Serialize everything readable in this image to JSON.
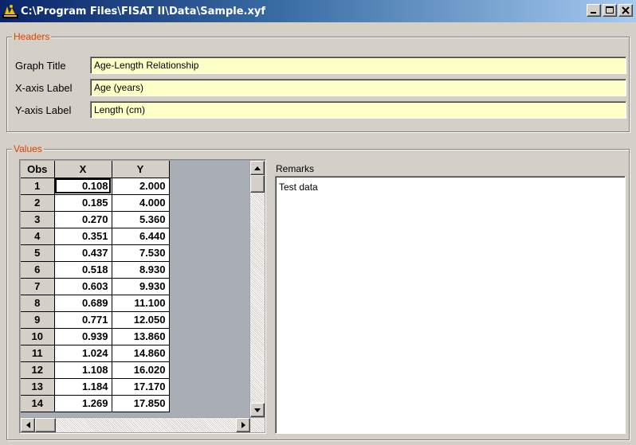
{
  "window": {
    "title": "C:\\Program Files\\FISAT II\\Data\\Sample.xyf",
    "icon": "fisat-app-icon"
  },
  "headers": {
    "legend": "Headers",
    "graph_title": {
      "label": "Graph Title",
      "value": "Age-Length Relationship"
    },
    "x_axis": {
      "label": "X-axis Label",
      "value": "Age (years)"
    },
    "y_axis": {
      "label": "Y-axis Label",
      "value": "Length (cm)"
    }
  },
  "values": {
    "legend": "Values",
    "columns": [
      "Obs",
      "X",
      "Y"
    ],
    "rows": [
      {
        "obs": "1",
        "x": "0.108",
        "y": "2.000"
      },
      {
        "obs": "2",
        "x": "0.185",
        "y": "4.000"
      },
      {
        "obs": "3",
        "x": "0.270",
        "y": "5.360"
      },
      {
        "obs": "4",
        "x": "0.351",
        "y": "6.440"
      },
      {
        "obs": "5",
        "x": "0.437",
        "y": "7.530"
      },
      {
        "obs": "6",
        "x": "0.518",
        "y": "8.930"
      },
      {
        "obs": "7",
        "x": "0.603",
        "y": "9.930"
      },
      {
        "obs": "8",
        "x": "0.689",
        "y": "11.100"
      },
      {
        "obs": "9",
        "x": "0.771",
        "y": "12.050"
      },
      {
        "obs": "10",
        "x": "0.939",
        "y": "13.860"
      },
      {
        "obs": "11",
        "x": "1.024",
        "y": "14.860"
      },
      {
        "obs": "12",
        "x": "1.108",
        "y": "16.020"
      },
      {
        "obs": "13",
        "x": "1.184",
        "y": "17.170"
      },
      {
        "obs": "14",
        "x": "1.269",
        "y": "17.850"
      }
    ],
    "remarks_label": "Remarks",
    "remarks_text": "Test data"
  }
}
